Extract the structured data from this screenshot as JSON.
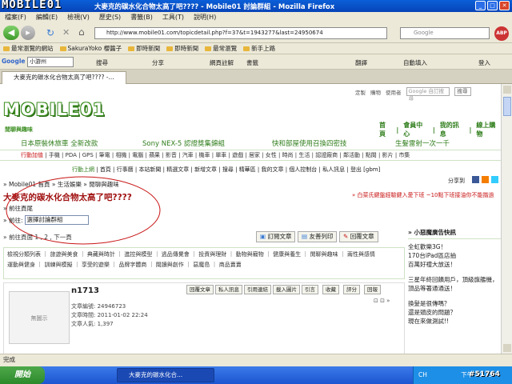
{
  "window": {
    "title": "大麥克的碳水化合物太高了吧???? - Mobile01 討論群組 - Mozilla Firefox",
    "watermark_logo": "MOBILE01"
  },
  "menu": [
    "檔案(F)",
    "編輯(E)",
    "檢視(V)",
    "歷史(S)",
    "書籤(B)",
    "工具(T)",
    "說明(H)"
  ],
  "nav": {
    "url": "http://www.mobile01.com/topicdetail.php?f=37&t=1943277&last=24950674",
    "search_placeholder": "Google"
  },
  "bookmarks": [
    "最常瀏覽的網站",
    "SakuraYoko 櫻醬子",
    "即時新聞",
    "即時新聞",
    "最常瀏覽",
    "新手上路"
  ],
  "google_toolbar": {
    "input": "小游州",
    "items": [
      "搜尋",
      "分享",
      "網頁註解",
      "書籤",
      "翻譯",
      "自動填入",
      "登入"
    ]
  },
  "tab": {
    "label": "大麥克的碳水化合物太高了吧???? -..."
  },
  "site": {
    "logo": "MOBILE01",
    "section": "閒聊與趣味",
    "top_links": [
      "定製",
      "購物",
      "使用者"
    ],
    "search_placeholder": "Google 自訂搜尋",
    "search_btn": "搜尋",
    "nav_links": [
      "首頁",
      "會員中心",
      "我的訊息",
      "線上購物"
    ],
    "promos": [
      "日本原裝休旅車 全新改款",
      "Sony NEX-5 認證獎集錦組",
      "快和部屋使用召換四密技",
      "生髮雷射一次一千"
    ],
    "categories": [
      "行動加值",
      "手機",
      "PDA",
      "GPS",
      "筆電",
      "相機",
      "電腦",
      "蘋果",
      "影音",
      "汽車",
      "機車",
      "單車",
      "遊戲",
      "居家",
      "女性",
      "時尚",
      "生活",
      "認證廠商",
      "鄰活動",
      "點閱",
      "影片",
      "市集"
    ],
    "subnav": [
      "行動上網",
      "首頁",
      "行事曆",
      "本站新聞",
      "精選文章",
      "新增文章",
      "搜尋",
      "精華區",
      "我的文章",
      "個人控制台",
      "私人訊息",
      "登出 [gbm]"
    ],
    "share_label": "分享到",
    "breadcrumb": "» Mobile01 首頁 » 生活娛樂 » 閒聊與趣味",
    "thread_title": "大麥克的碳水化合物太高了吧????",
    "forward_label": "» 前往頁尾",
    "goto_label": "» 前往:",
    "goto_select": "選擇討論群組",
    "red_link": "» 白菜氏鍵盤經驗鍵入愛下班 ~10點下班接油你不能揩過",
    "pagination": "» 前往頁面 1 , 2 , 下一頁",
    "action_buttons": [
      "訂閱文章",
      "友善列印",
      "回覆文章"
    ],
    "forum_tags_row1": "檢視分類列表 ｜ 旅遊與美食 ｜ 典藏與時計 ｜ 進控與模型 ｜ 逃品傳覺會 ｜ 投資與理財 ｜ 動物與寵物 ｜ 健康與養生 ｜ 閒聊與趣味 ｜ 兩性與感情",
    "forum_tags_row2": "運動與健身 ｜ 訓練與模擬 ｜ 享受的遊樂 ｜ 品牌字體商 ｜ 閱讀與創作 ｜ 惡魔島 ｜ 商品賣賣",
    "sidebar": {
      "title": "小惡魔廣告快訊",
      "items": [
        "全虹歡樂3G！",
        "170台iPad區店抽",
        "百萬好禮大放送！",
        "三星年終回饋用戶，頂級旗艦機，頂品等著通通送！",
        "換髮是很傳嗎？",
        "還是頭皮的問題？",
        "現在來做測試!!"
      ]
    },
    "post": {
      "author": "n1713",
      "avatar_label": "無圖示",
      "post_id_label": "文章編號:",
      "post_id": "24946723",
      "time_label": "文章時間:",
      "time": "2011-01-02 22:24",
      "count_label": "文章人氣:",
      "count": "1,397",
      "buttons": [
        "回覆文章",
        "私人訊息",
        "引用連結",
        "載入圖片",
        "引言",
        "收藏",
        "評分",
        "回報"
      ]
    }
  },
  "status": "完成",
  "taskbar": {
    "start": "開始",
    "item": "大麥克的碳水化合...",
    "tray": "CH",
    "clock": "下午 10:35"
  },
  "bottom_watermark": "#51764"
}
